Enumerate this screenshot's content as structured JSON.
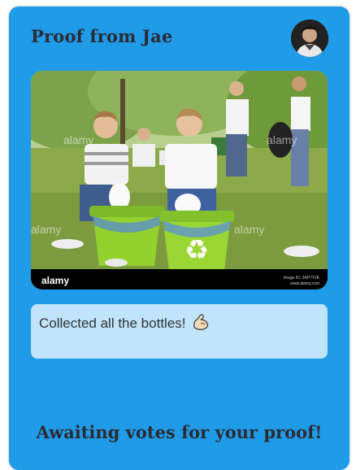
{
  "header": {
    "title": "Proof from Jae"
  },
  "avatar": {
    "icon": "user-avatar-photo"
  },
  "proof_image": {
    "watermark_text": "alamy",
    "footer_logo": "alamy",
    "footer_id": "Image ID: 2AP7YJK",
    "footer_url": "www.alamy.com"
  },
  "caption": {
    "text": "Collected all the bottles!",
    "emoji_icon": "flexed-biceps-icon"
  },
  "status": {
    "text": "Awaiting votes for your proof!"
  },
  "colors": {
    "card_background": "#1f9be8",
    "caption_background": "#bfe4fb",
    "text": "#2b2b33"
  }
}
